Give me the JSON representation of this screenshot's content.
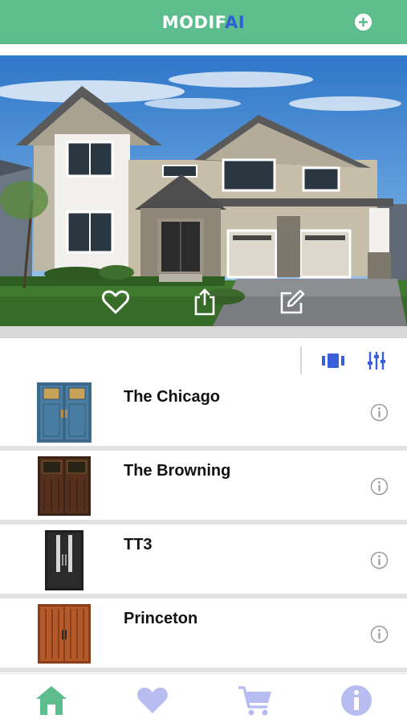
{
  "header": {
    "logo_part1": "MODIF",
    "logo_part2": "AI",
    "add_icon": "plus-circle-icon",
    "bg_color": "#5dbd8d",
    "accent_color": "#2e5fd6"
  },
  "hero": {
    "actions": [
      "heart-icon",
      "share-icon",
      "edit-icon"
    ]
  },
  "toolbar": {
    "compare_icon": "carousel-icon",
    "filter_icon": "sliders-icon",
    "icon_color": "#3a5fd9"
  },
  "products": [
    {
      "name": "The Chicago",
      "info_icon": "info-icon"
    },
    {
      "name": "The Browning",
      "info_icon": "info-icon"
    },
    {
      "name": "TT3",
      "info_icon": "info-icon"
    },
    {
      "name": "Princeton",
      "info_icon": "info-icon"
    }
  ],
  "tabbar": {
    "items": [
      "home-icon",
      "favorites-icon",
      "cart-icon",
      "info-icon"
    ],
    "active_color": "#5dbd8d",
    "inactive_color": "#b7bdf0"
  }
}
